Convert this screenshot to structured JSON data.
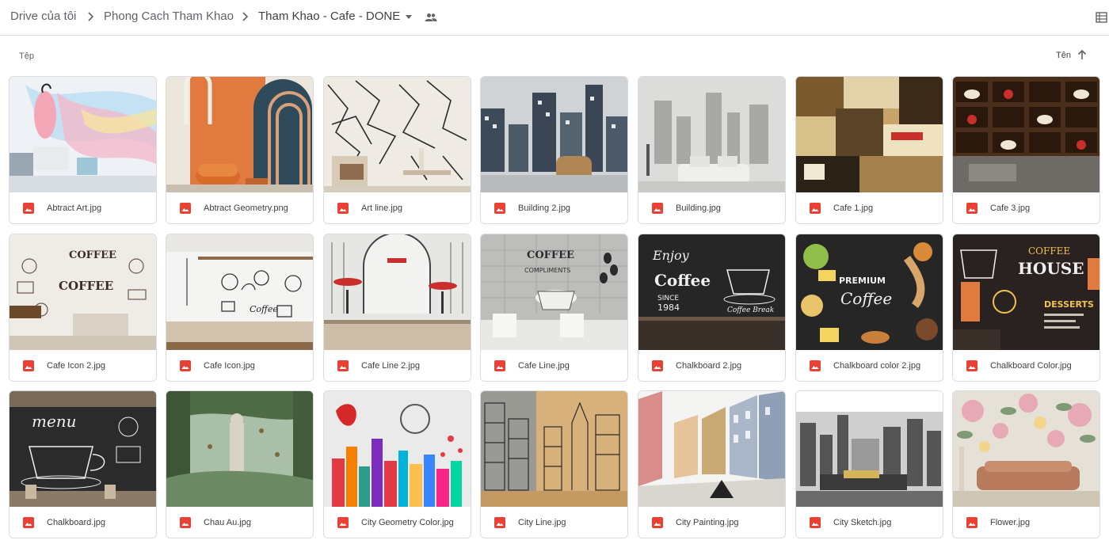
{
  "breadcrumb": {
    "root": "Drive của tôi",
    "parent": "Phong Cach Tham Khao",
    "current": "Tham Khao - Cafe - DONE"
  },
  "list_header": {
    "files_label": "Tệp",
    "sort_label": "Tên"
  },
  "icons": {
    "separator": "chevron-right-icon",
    "dropdown": "caret-down-icon",
    "shared": "people-icon",
    "view": "list-view-icon",
    "sort": "arrow-up-icon",
    "file": "image-file-icon"
  },
  "colors": {
    "image_icon": "#e94235",
    "border": "#dadce0"
  },
  "files": [
    {
      "name": "Abtract Art.jpg",
      "theme": "art"
    },
    {
      "name": "Abtract Geometry.png",
      "theme": "geometry"
    },
    {
      "name": "Art line.jpg",
      "theme": "artline"
    },
    {
      "name": "Building 2.jpg",
      "theme": "building2"
    },
    {
      "name": "Building.jpg",
      "theme": "building"
    },
    {
      "name": "Cafe 1.jpg",
      "theme": "collage"
    },
    {
      "name": "Cafe 3.jpg",
      "theme": "shelves"
    },
    {
      "name": "Cafe Icon 2.jpg",
      "theme": "cafeicon2"
    },
    {
      "name": "Cafe Icon.jpg",
      "theme": "cafeicon"
    },
    {
      "name": "Cafe Line 2.jpg",
      "theme": "cafeline2"
    },
    {
      "name": "Cafe Line.jpg",
      "theme": "cafeline"
    },
    {
      "name": "Chalkboard 2.jpg",
      "theme": "chalk2"
    },
    {
      "name": "Chalkboard color 2.jpg",
      "theme": "chalkcolor2"
    },
    {
      "name": "Chalkboard Color.jpg",
      "theme": "chalkcolor"
    },
    {
      "name": "Chalkboard.jpg",
      "theme": "chalk"
    },
    {
      "name": "Chau Au.jpg",
      "theme": "chauau"
    },
    {
      "name": "City Geometry Color.jpg",
      "theme": "citygeo"
    },
    {
      "name": "City Line.jpg",
      "theme": "cityline"
    },
    {
      "name": "City Painting.jpg",
      "theme": "citypaint"
    },
    {
      "name": "City Sketch.jpg",
      "theme": "citysketch"
    },
    {
      "name": "Flower.jpg",
      "theme": "flower"
    }
  ],
  "thumb_text": {
    "coffee": "COFFEE",
    "coffee_script": "Coffee",
    "menu": "menu",
    "house": "HOUSE",
    "premium": "PREMIUM",
    "enjoy": "Enjoy",
    "since": "SINCE",
    "year": "1984",
    "coffee_break": "Coffee Break",
    "compliments": "COMPLIMENTS",
    "desserts": "DESSERTS"
  }
}
